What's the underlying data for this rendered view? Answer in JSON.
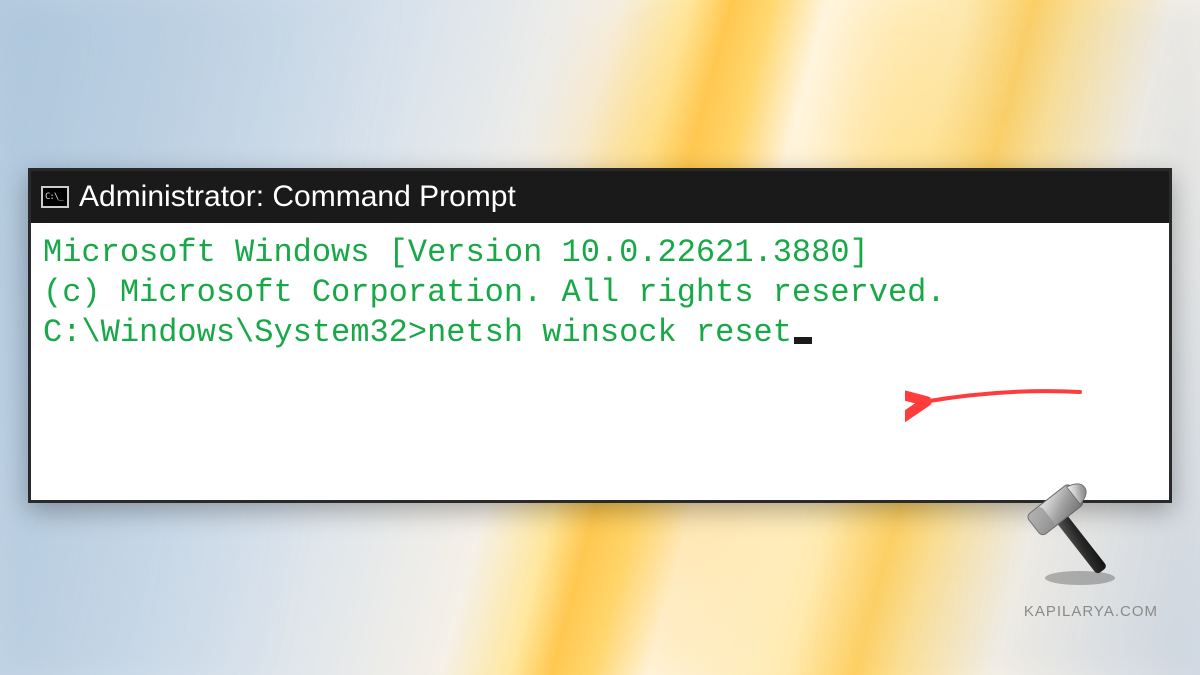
{
  "window": {
    "title": "Administrator: Command Prompt"
  },
  "terminal": {
    "line1": "Microsoft Windows [Version 10.0.22621.3880]",
    "line2": "(c) Microsoft Corporation. All rights reserved.",
    "blank": "",
    "prompt": "C:\\Windows\\System32>",
    "command": "netsh winsock reset"
  },
  "watermark": "KAPILARYA.COM",
  "annotation": {
    "arrow_color": "#ff3b3b"
  }
}
